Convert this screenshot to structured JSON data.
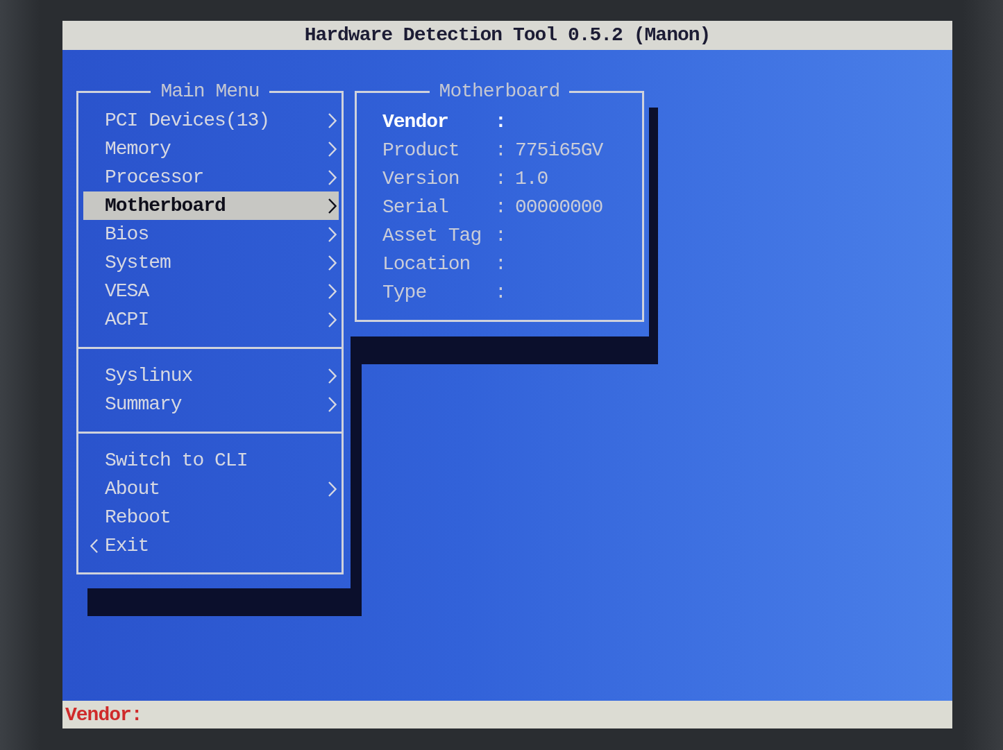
{
  "title_bar": {
    "title": "Hardware Detection Tool 0.5.2 (Manon)"
  },
  "main_menu": {
    "title": "Main Menu",
    "groups": [
      {
        "items": [
          {
            "label": "PCI Devices(13)",
            "kind": "submenu",
            "selected": false
          },
          {
            "label": "Memory",
            "kind": "submenu",
            "selected": false
          },
          {
            "label": "Processor",
            "kind": "submenu",
            "selected": false
          },
          {
            "label": "Motherboard",
            "kind": "submenu",
            "selected": true
          },
          {
            "label": "Bios",
            "kind": "submenu",
            "selected": false
          },
          {
            "label": "System",
            "kind": "submenu",
            "selected": false
          },
          {
            "label": "VESA",
            "kind": "submenu",
            "selected": false
          },
          {
            "label": "ACPI",
            "kind": "submenu",
            "selected": false
          }
        ]
      },
      {
        "items": [
          {
            "label": "Syslinux",
            "kind": "submenu",
            "selected": false
          },
          {
            "label": "Summary",
            "kind": "submenu",
            "selected": false
          }
        ]
      },
      {
        "items": [
          {
            "label": "Switch to CLI",
            "kind": "action",
            "selected": false
          },
          {
            "label": "About",
            "kind": "submenu",
            "selected": false
          },
          {
            "label": "Reboot",
            "kind": "action",
            "selected": false
          },
          {
            "label": "Exit",
            "kind": "back",
            "selected": false
          }
        ]
      }
    ]
  },
  "detail_panel": {
    "title": "Motherboard",
    "fields": [
      {
        "label": "Vendor",
        "separator": ":",
        "selected": true
      },
      {
        "label": "Product",
        "separator": ":",
        "value": "775i65GV",
        "selected": false
      },
      {
        "label": "Version",
        "separator": ":",
        "value": "1.0",
        "selected": false
      },
      {
        "label": "Serial",
        "separator": ":",
        "value": "00000000",
        "selected": false
      },
      {
        "label": "Asset Tag",
        "separator": ":",
        "selected": false
      },
      {
        "label": "Location",
        "separator": ":",
        "selected": false
      },
      {
        "label": "Type",
        "separator": ":",
        "selected": false
      }
    ]
  },
  "status_bar": {
    "text": "Vendor:"
  }
}
